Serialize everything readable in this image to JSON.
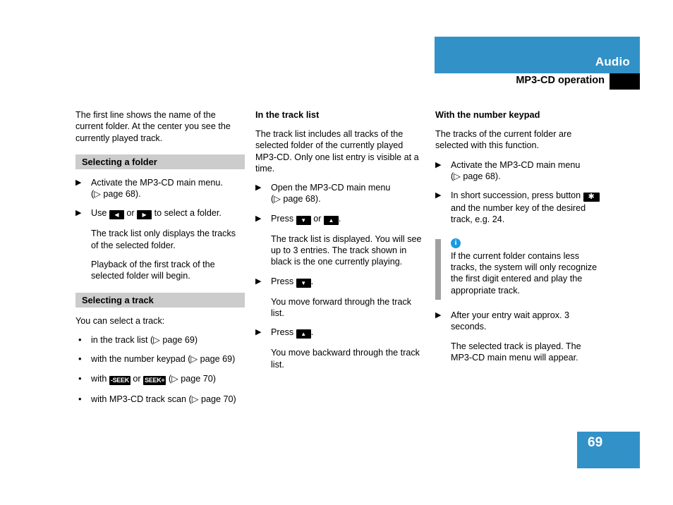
{
  "header": {
    "section_title": "Audio",
    "page_subtitle": "MP3-CD operation",
    "accent_color": "#3292c8",
    "marker_color": "#000000"
  },
  "footer": {
    "page_number": "69",
    "box_color": "#3292c8"
  },
  "columns": {
    "left": {
      "intro": "The first line shows the name of the current folder. At the center you see the currently played track.",
      "section_folder": {
        "heading": "Selecting a folder",
        "step1_text": "Activate the MP3-CD main menu.",
        "step1_ref": "(▷ page 68).",
        "step2_pre": "Use",
        "step2_key_left": "◀",
        "step2_mid": "or",
        "step2_key_right": "▶",
        "step2_post": "to select a folder.",
        "result1": "The track list only displays the tracks of the selected folder.",
        "result2": "Playback of the first track of the selected folder will begin."
      },
      "section_track": {
        "heading": "Selecting a track",
        "lead": "You can select a track:",
        "items": [
          {
            "pre": "in the track list (▷ page 69)",
            "key": "",
            "post": ""
          },
          {
            "pre": "with the number keypad (▷ page 69)",
            "key": "",
            "post": ""
          },
          {
            "pre": "with",
            "key": "-SEEK",
            "key2": "SEEK+",
            "mid": "or",
            "post": "(▷ page 70)"
          },
          {
            "pre": "with MP3-CD track scan (▷ page 70)",
            "key": "",
            "post": ""
          }
        ]
      }
    },
    "middle": {
      "heading": "In the track list",
      "intro": "The track list includes all tracks of the selected folder of the currently played MP3-CD. Only one list entry is visible at a time.",
      "step1_text": "Open the MP3-CD main menu",
      "step1_ref": "(▷ page 68).",
      "step2_pre": "Press",
      "step2_key_down": "▼",
      "step2_mid": "or",
      "step2_key_up": "▲",
      "step2_post": ".",
      "result1": "The track list is displayed. You will see up to 3 entries. The track shown in black is the one currently playing.",
      "step3_pre": "Press",
      "step3_key": "▼",
      "step3_post": ".",
      "result2": "You move forward through the track list.",
      "step4_pre": "Press",
      "step4_key": "▲",
      "step4_post": ".",
      "result3": "You move backward through the track list."
    },
    "right": {
      "heading": "With the number keypad",
      "intro": "The tracks of the current folder are selected with this function.",
      "step1_text": "Activate the MP3-CD main menu",
      "step1_ref": "(▷ page 68).",
      "step2_pre": "In short succession, press button",
      "step2_key": "✱",
      "step2_post": "and the number key of the desired track, e.g. 24.",
      "note": {
        "icon_label": "i",
        "icon_color": "#1b9ae0",
        "text": "If the current folder contains less tracks, the system will only recognize the first digit entered and play the appropriate track."
      },
      "step3_text": "After your entry wait approx. 3 seconds.",
      "result1": "The selected track is played. The MP3-CD main menu will appear."
    }
  },
  "glyphs": {
    "step_marker": "▶",
    "bullet_marker": "•"
  }
}
